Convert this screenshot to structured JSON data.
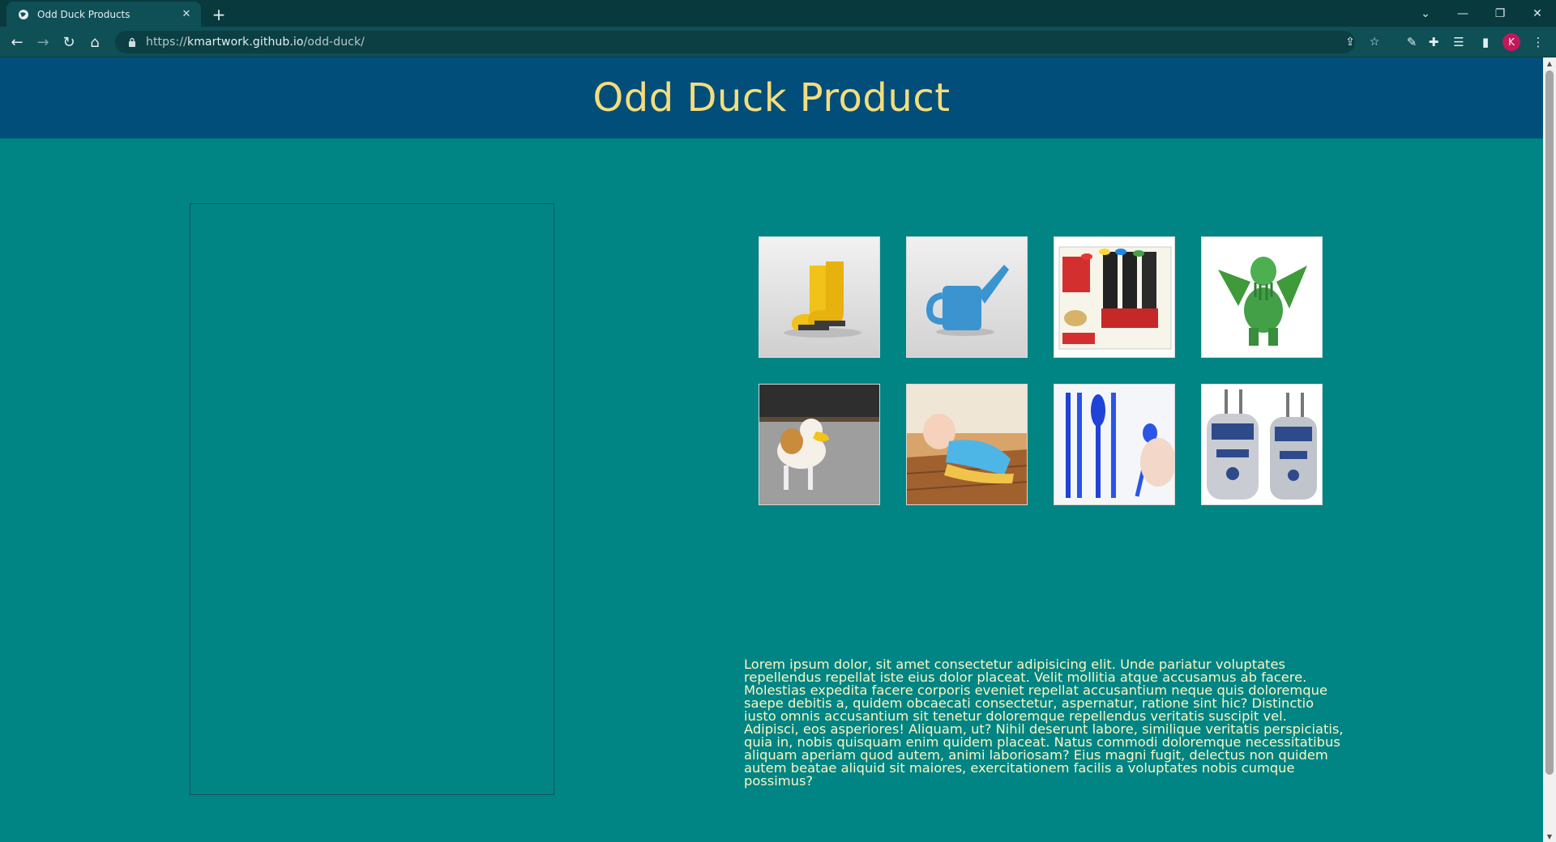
{
  "browser": {
    "tab_title": "Odd Duck Products",
    "url_host": "kmartwork.github.io",
    "url_prefix": "https://",
    "url_path": "/odd-duck/",
    "avatar_initial": "K"
  },
  "page": {
    "heading": "Odd Duck Product",
    "products": [
      {
        "icon": "boots-image"
      },
      {
        "icon": "watering-can-mug-image"
      },
      {
        "icon": "pet-sweep-image"
      },
      {
        "icon": "cthulhu-figure-image"
      },
      {
        "icon": "dog-duck-bill-image"
      },
      {
        "icon": "baby-sweeper-image"
      },
      {
        "icon": "blue-utensils-image"
      },
      {
        "icon": "r2d2-luggage-image"
      }
    ],
    "lorem": "Lorem ipsum dolor, sit amet consectetur adipisicing elit. Unde pariatur voluptates repellendus repellat iste eius dolor placeat. Velit mollitia atque accusamus ab facere. Molestias expedita facere corporis eveniet repellat accusantium neque quis doloremque saepe debitis a, quidem obcaecati consectetur, aspernatur, ratione sint hic? Distinctio iusto omnis accusantium sit tenetur doloremque repellendus veritatis suscipit vel. Adipisci, eos asperiores! Aliquam, ut? Nihil deserunt labore, similique veritatis perspiciatis, quia in, nobis quisquam enim quidem placeat. Natus commodi doloremque necessitatibus aliquam aperiam quod autem, animi laboriosam? Eius magni fugit, delectus non quidem autem beatae aliquid sit maiores, exercitationem facilis a voluptates nobis cumque possimus?"
  },
  "colors": {
    "header_bg": "#004e79",
    "heading_text": "#f4dd7d",
    "page_bg": "#008484",
    "body_text": "#fbf6c4"
  }
}
